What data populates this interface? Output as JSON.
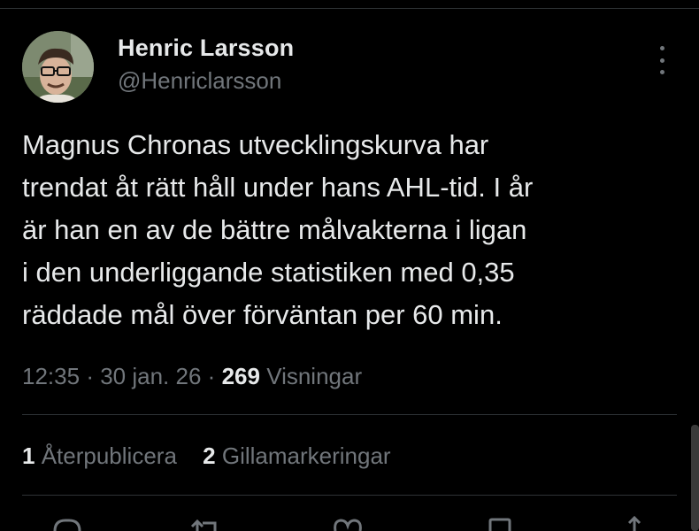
{
  "author": {
    "name": "Henric Larsson",
    "handle": "@Henriclarsson",
    "avatar": "profile-photo"
  },
  "tweet": {
    "lines": [
      "Magnus Chronas utvecklingskurva har",
      "trendat åt rätt håll under hans AHL-tid. I år",
      "är han en av de bättre målvakterna i ligan",
      "i den underliggande statistiken med 0,35",
      "räddade mål över förväntan per 60 min."
    ]
  },
  "meta": {
    "time": "12:35",
    "date": "30 jan. 26",
    "views_count": "269",
    "views_label": "Visningar",
    "separator": "·"
  },
  "stats": {
    "reposts_count": "1",
    "reposts_label": "Återpublicera",
    "likes_count": "2",
    "likes_label": "Gillamarkeringar"
  },
  "icons": [
    "more-icon",
    "reply-icon",
    "repost-icon",
    "like-icon",
    "bookmark-icon"
  ],
  "colors": {
    "background": "#000000",
    "text": "#e7e9ea",
    "secondary": "#71767b",
    "divider": "#2f3336"
  }
}
